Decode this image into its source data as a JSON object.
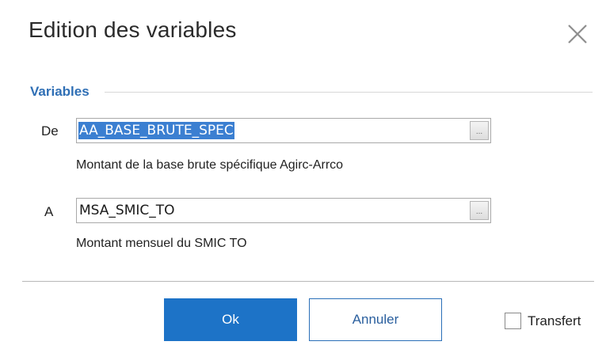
{
  "dialog": {
    "title": "Edition des variables"
  },
  "section": {
    "label": "Variables"
  },
  "from": {
    "label": "De",
    "value": "AA_BASE_BRUTE_SPEC",
    "description": "Montant de la base brute spécifique Agirc-Arrco",
    "browse_glyph": "..."
  },
  "to": {
    "label": "A",
    "value": "MSA_SMIC_TO",
    "description": "Montant mensuel du SMIC TO",
    "browse_glyph": "..."
  },
  "buttons": {
    "ok_label": "Ok",
    "cancel_label": "Annuler"
  },
  "transfer": {
    "label": "Transfert",
    "checked": false
  },
  "colors": {
    "accent": "#1d73c7",
    "section_label": "#2f6fb5",
    "selection": "#3b7fd1"
  },
  "icons": {
    "close": "close-icon",
    "browse": "ellipsis-icon"
  }
}
